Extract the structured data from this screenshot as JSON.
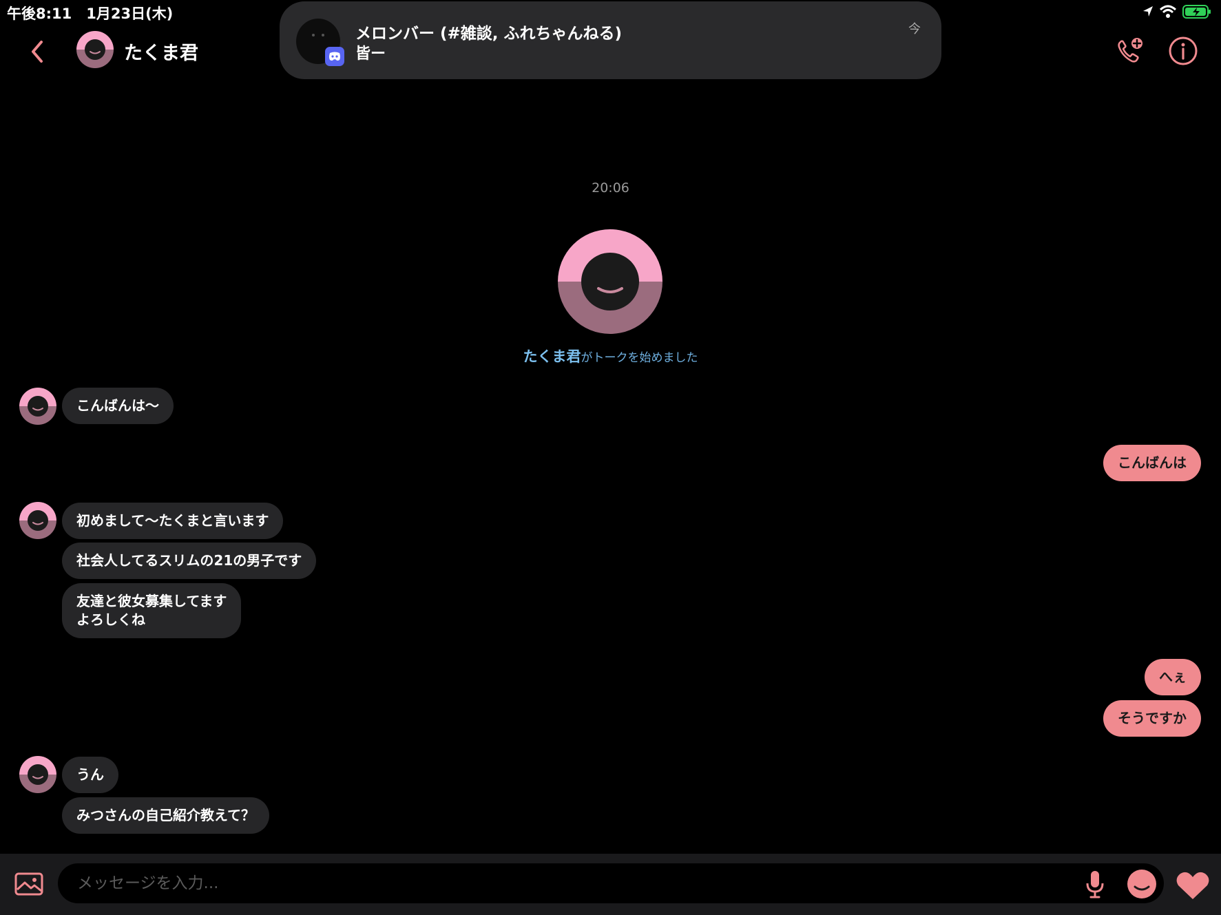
{
  "status_bar": {
    "time": "午後8:11　1月23日(木)"
  },
  "header": {
    "name": "たくま君"
  },
  "notification": {
    "title": "メロンバー (#雑談, ふれちゃんねる)",
    "body": "皆ー",
    "time": "今"
  },
  "chat": {
    "timestamp": "20:06",
    "started_name": "たくま君",
    "started_text": "がトークを始めました",
    "messages": [
      {
        "from": "them",
        "text": "こんばんは〜"
      },
      {
        "from": "me",
        "text": "こんばんは"
      },
      {
        "from": "them",
        "text": "初めまして〜たくまと言います"
      },
      {
        "from": "them",
        "text": "社会人してるスリムの21の男子です"
      },
      {
        "from": "them",
        "text": "友達と彼女募集してます\nよろしくね"
      },
      {
        "from": "me",
        "text": "へぇ"
      },
      {
        "from": "me",
        "text": "そうですか"
      },
      {
        "from": "them",
        "text": "うん"
      },
      {
        "from": "them",
        "text": "みつさんの自己紹介教えて？"
      }
    ]
  },
  "input": {
    "placeholder": "メッセージを入力..."
  },
  "icons": [
    "back-chevron-icon",
    "discord-icon",
    "add-call-icon",
    "info-icon",
    "image-icon",
    "mic-icon",
    "smiley-icon",
    "heart-icon"
  ],
  "colors": {
    "accent_pink": "#f08a8f",
    "avatar_pink": "#f7a6c8",
    "link_blue": "#6fb0e0",
    "bubble_dark": "#262628"
  }
}
